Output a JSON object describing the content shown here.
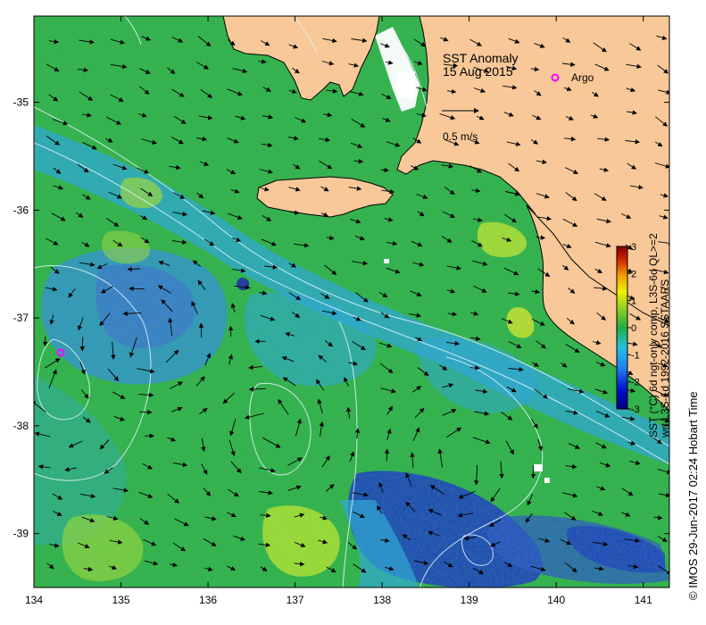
{
  "title": "SST Anomaly",
  "date": "15 Aug 2015",
  "argo_label": "Argo",
  "vector_scale_label": "0.5 m/s",
  "colorbar": {
    "label_line1": "SST (°C) 6d ngt-only comp, L3S-6d QL>=2",
    "label_line2": "wrt L3S-1d 1992-2016 SSTAARS",
    "ticks": [
      "3",
      "2",
      "1",
      "0",
      "-1",
      "-2",
      "-3"
    ],
    "range": [
      -3,
      3
    ]
  },
  "credit": "© IMOS 29-Jun-2017 02:24 Hobart Time",
  "axes": {
    "x_ticks": [
      "134",
      "135",
      "136",
      "137",
      "138",
      "139",
      "140",
      "141"
    ],
    "y_ticks": [
      "-35",
      "-36",
      "-37",
      "-38",
      "-39"
    ],
    "xlim": [
      134,
      141.3
    ],
    "ylim": [
      -39.5,
      -34.2
    ]
  },
  "argo_floats": [
    {
      "lon": 140.0,
      "lat": -34.58
    },
    {
      "lon": 134.3,
      "lat": -37.28
    }
  ],
  "colors": {
    "land": "#f8c898",
    "ocean_base": "#2fb24a",
    "anomaly_cool": "#2aa6e6",
    "anomaly_cold": "#1a3ac8",
    "anomaly_warm": "#b9e62e",
    "argo": "#ff00ff",
    "contour": "#e6f4ff"
  }
}
